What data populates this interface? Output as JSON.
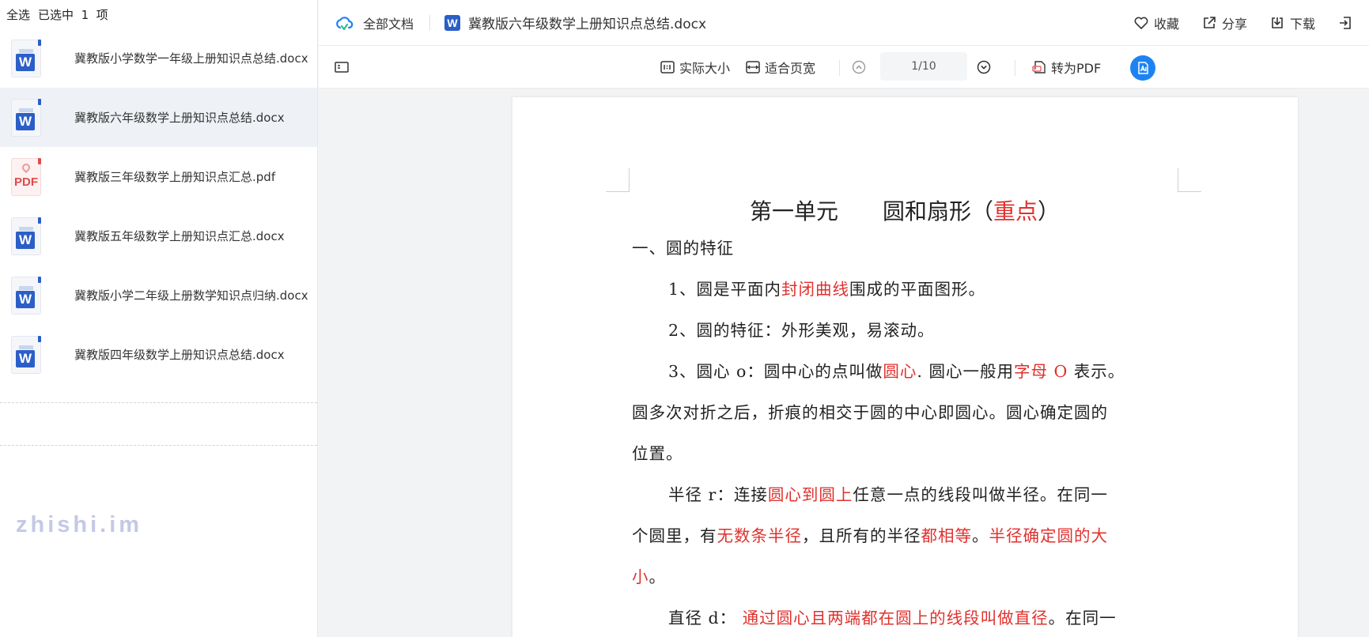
{
  "sidebar": {
    "select_all": "全选",
    "selected_prefix": "已选中",
    "selected_count": "1",
    "selected_suffix": "项",
    "files": [
      {
        "name": "冀教版小学数学一年级上册知识点总结.docx",
        "type": "word",
        "tag": "W"
      },
      {
        "name": "冀教版六年级数学上册知识点总结.docx",
        "type": "word",
        "tag": "W"
      },
      {
        "name": "冀教版三年级数学上册知识点汇总.pdf",
        "type": "pdf",
        "tag": "PDF"
      },
      {
        "name": "冀教版五年级数学上册知识点汇总.docx",
        "type": "word",
        "tag": "W"
      },
      {
        "name": "冀教版小学二年级上册数学知识点归纳.docx",
        "type": "word",
        "tag": "W"
      },
      {
        "name": "冀教版四年级数学上册知识点总结.docx",
        "type": "word",
        "tag": "W"
      }
    ],
    "watermark": "zhishi.im"
  },
  "header": {
    "all_docs": "全部文档",
    "doc_icon_letter": "W",
    "doc_title": "冀教版六年级数学上册知识点总结.docx",
    "favorite": "收藏",
    "share": "分享",
    "download": "下载"
  },
  "toolbar": {
    "actual_size": "实际大小",
    "fit_width": "适合页宽",
    "page_indicator": "1/10",
    "to_pdf": "转为PDF"
  },
  "document": {
    "heading": {
      "a": "第一单元　　圆和扇形（",
      "b": "重点",
      "c": "）"
    },
    "s1": "一、圆的特征",
    "l1": {
      "a": "1、圆是平面内",
      "b": "封闭曲线",
      "c": "围成的平面图形。"
    },
    "l2": "2、圆的特征：外形美观，易滚动。",
    "l3": {
      "a": "3、圆心 o：圆中心的点叫做",
      "b": "圆心",
      "c": ". 圆心一般用",
      "d": "字母 O",
      "e": " 表示。"
    },
    "l4": "圆多次对折之后，折痕的相交于圆的中心即圆心。圆心确定圆的",
    "l5": "位置。",
    "l6": {
      "a": "半径 r：连接",
      "b": "圆心到圆上",
      "c": "任意一点的线段叫做半径。在同一"
    },
    "l7": {
      "a": "个圆里，有",
      "b": "无数条半径",
      "c": "，且所有的半径",
      "d": "都相等",
      "e": "。",
      "f": "半径确定圆的大"
    },
    "l8": {
      "a": "小",
      "b": "。"
    },
    "l9": {
      "a": "直径 d：",
      "b": "通过圆心且两端都在圆上的线段叫做直径",
      "c": "。在同一"
    }
  },
  "colors": {
    "highlight": "#e0312d",
    "accent": "#1e83f2",
    "word_blue": "#2b5fc7",
    "pdf_red": "#e14b4b"
  }
}
